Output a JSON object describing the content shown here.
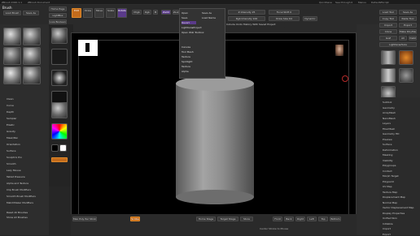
{
  "titlebar": {
    "app": "ZBrush 2020.1.1",
    "doc": "ZBrush Document",
    "menu_items": [
      "Alpha",
      "Brush",
      "Color",
      "Document",
      "Draw",
      "Dynamics",
      "Edit",
      "File",
      "Layer",
      "Light",
      "Macro",
      "Marker",
      "Material",
      "Movie",
      "Picker",
      "Preferences",
      "Render",
      "Stencil",
      "Stroke",
      "Texture",
      "Tool",
      "Transform",
      "Zplugin",
      "Zscript",
      "Help"
    ],
    "quicksave": "QuickSave",
    "see_through": "See-through 0",
    "menus_label": "Menus",
    "default_script": "DefaultZScript"
  },
  "toolbar": {
    "brush_label": "Brush",
    "load_brush": "Load Brush",
    "save_as": "Save As",
    "home_page": "Home Page",
    "lightbox": "LightBox",
    "live_boolean": "Live Boolean",
    "edit": "Edit",
    "draw": "Draw",
    "move": "Move",
    "scale": "Scale",
    "rotate": "Rotate",
    "mrgb": "Mrgb",
    "rgb": "Rgb",
    "m": "M",
    "zadd": "Zadd",
    "zsub": "Zsub",
    "focal_shift": "Focal Shift 0",
    "draw_size": "Draw Size 64",
    "dynamic": "Dynamic",
    "z_intensity": "Z Intensity 25",
    "rgb_intensity": "Rgb Intensity 100",
    "undo_history": "Include Undo History With Saved Project"
  },
  "dropdown": {
    "items": [
      "Open",
      "Save",
      "Revert",
      "Lightbox▸Project",
      "Open Wiki Toolbox",
      "Canvas",
      "Tool Mesh",
      "Texture",
      "Spotlight",
      "Texture",
      "Alpha"
    ],
    "right_items": [
      "Save As",
      "Load Name"
    ],
    "highlighted": "Revert"
  },
  "left_panel": {
    "items": [
      "Clean",
      "Curve",
      "Depth",
      "Sampler",
      "Elastic",
      "Gravity",
      "Mask/Pen",
      "Orientation",
      "Surface",
      "Sculptrix Pro",
      "Smooth",
      "Lazy Mouse",
      "Tablet Pressure",
      "Alpha and Texture",
      "Clip Brush Modifiers",
      "Smooth Brush Modifiers",
      "MatchMaker Modifiers"
    ],
    "bottom_items": [
      "Reset All Brushes",
      "Show All Brushes"
    ]
  },
  "right_panel": {
    "buttons": [
      "Load Tool",
      "Save As",
      "Copy Tool",
      "Paste Tool",
      "Import",
      "Export",
      "Clone",
      "Make PolyMesh3D",
      "GoZ",
      "All",
      "Visible",
      "R",
      "Lightbox▸Tools",
      "Cylinder3D"
    ],
    "list": [
      "Subtool",
      "Geometry",
      "ArrayMesh",
      "NanoMesh",
      "Layers",
      "FiberMesh",
      "Geometry HD",
      "Preview",
      "Surface",
      "Deformation",
      "Masking",
      "Visibility",
      "Polygroups",
      "Contact",
      "Morph Target",
      "Polypaint",
      "UV Map",
      "Texture Map",
      "Displacement Map",
      "Normal Map",
      "Vector Displacement Map",
      "Display Properties",
      "Unified Skin",
      "Initialize",
      "Import",
      "Export"
    ]
  },
  "bottombar": {
    "smt": "Smt",
    "max_poly": "Max Poly Per Stroke 1",
    "scribe": "Scribe",
    "home_stage": "Home Stage",
    "target_stage": "Target Stage",
    "store": "Store",
    "front": "Front",
    "back": "Back",
    "right": "Right",
    "left": "Left",
    "top": "Top",
    "bottom": "Bottom",
    "status": "Center Stroke to Mouse"
  },
  "colors": {
    "accent": "#c26b1c",
    "highlight": "#5a3a8a",
    "canvas_bg": "#000000",
    "model": "#8e8e8e"
  }
}
